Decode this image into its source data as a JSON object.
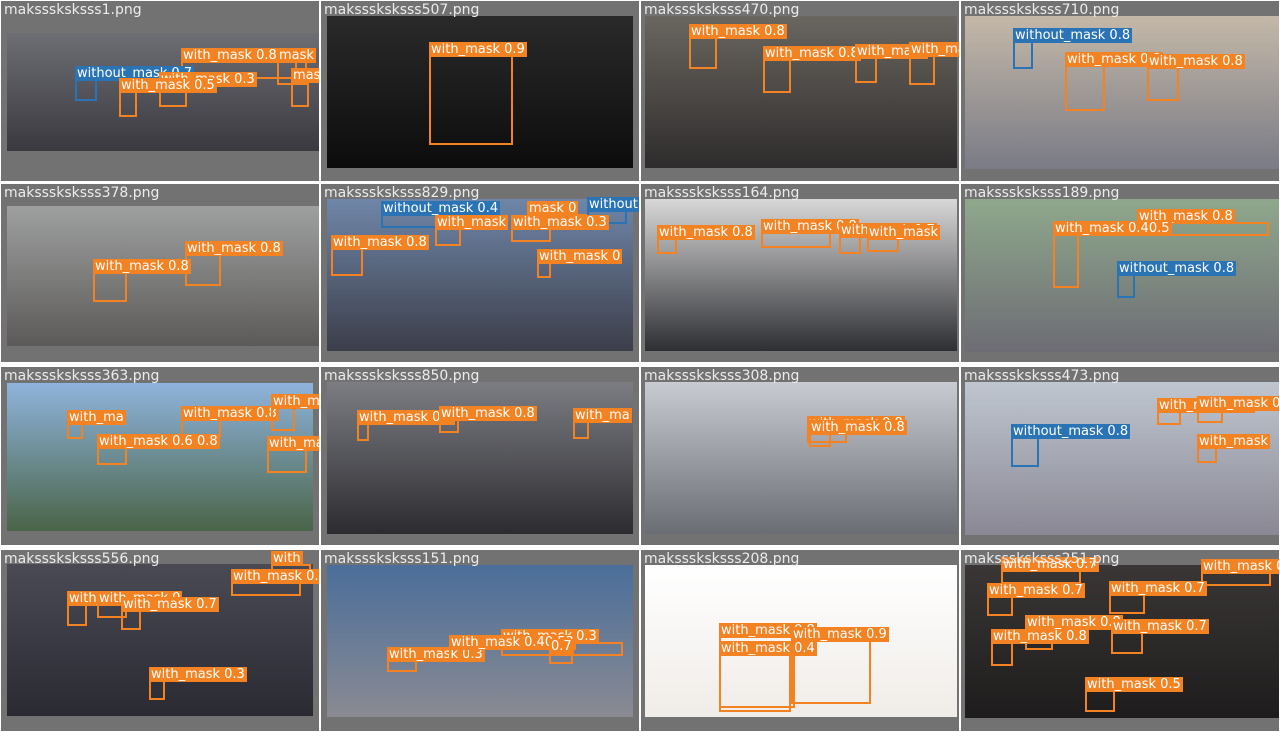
{
  "colors": {
    "with_mask": "#f28222",
    "without_mask": "#2a74b5",
    "tile_border": "#727272",
    "filename_text": "#ececec"
  },
  "tiles": [
    {
      "file": "maksssksksss1.png",
      "dets": [
        {
          "label": "with_mask 0.8",
          "cls": "with"
        },
        {
          "label": "without_mask 0.7",
          "cls": "without"
        },
        {
          "label": "with_mask 0.3",
          "cls": "with"
        },
        {
          "label": "with_mask 0.5",
          "cls": "with"
        },
        {
          "label": "mask",
          "cls": "with"
        },
        {
          "label": "mask",
          "cls": "with"
        }
      ]
    },
    {
      "file": "maksssksksss507.png",
      "dets": [
        {
          "label": "with_mask 0.9",
          "cls": "with"
        }
      ]
    },
    {
      "file": "maksssksksss470.png",
      "dets": [
        {
          "label": "with_mask 0.8",
          "cls": "with"
        },
        {
          "label": "with_mask 0.8",
          "cls": "with"
        },
        {
          "label": "with_mask",
          "cls": "with"
        },
        {
          "label": "with_mask",
          "cls": "with"
        }
      ]
    },
    {
      "file": "maksssksksss710.png",
      "dets": [
        {
          "label": "without_mask 0.8",
          "cls": "without"
        },
        {
          "label": "with_mask 0.8",
          "cls": "with"
        },
        {
          "label": "with_mask 0.8",
          "cls": "with"
        }
      ]
    },
    {
      "file": "maksssksksss378.png",
      "dets": [
        {
          "label": "with_mask 0.8",
          "cls": "with"
        },
        {
          "label": "with_mask 0.8",
          "cls": "with"
        }
      ]
    },
    {
      "file": "maksssksksss829.png",
      "dets": [
        {
          "label": "without_mask 0.4",
          "cls": "without"
        },
        {
          "label": "mask 0",
          "cls": "with"
        },
        {
          "label": "without",
          "cls": "without"
        },
        {
          "label": "with_mask 0.8",
          "cls": "with"
        },
        {
          "label": "with_mask",
          "cls": "with"
        },
        {
          "label": "with_mask 0.3",
          "cls": "with"
        },
        {
          "label": "with_mask 0",
          "cls": "with"
        }
      ]
    },
    {
      "file": "maksssksksss164.png",
      "dets": [
        {
          "label": "with_mask 0.8",
          "cls": "with"
        },
        {
          "label": "with_mask 0.8",
          "cls": "with"
        },
        {
          "label": "with_mask 0.7",
          "cls": "with"
        },
        {
          "label": "with_mask",
          "cls": "with"
        }
      ]
    },
    {
      "file": "maksssksksss189.png",
      "dets": [
        {
          "label": "with_mask 0.8",
          "cls": "with"
        },
        {
          "label": "with_mask 0.40.5",
          "cls": "with"
        },
        {
          "label": "without_mask 0.8",
          "cls": "without"
        }
      ]
    },
    {
      "file": "maksssksksss363.png",
      "dets": [
        {
          "label": "with_ma",
          "cls": "with"
        },
        {
          "label": "with_mask 0.8",
          "cls": "with"
        },
        {
          "label": "with_mask 0.8",
          "cls": "with"
        },
        {
          "label": "with_mask 0.6 0.8",
          "cls": "with"
        },
        {
          "label": "with_ma",
          "cls": "with"
        }
      ]
    },
    {
      "file": "maksssksksss850.png",
      "dets": [
        {
          "label": "with_mask 0.8",
          "cls": "with"
        },
        {
          "label": "with_mask 0.8",
          "cls": "with"
        },
        {
          "label": "with_ma",
          "cls": "with"
        }
      ]
    },
    {
      "file": "maksssksksss308.png",
      "dets": [
        {
          "label": "with_mask 0.8",
          "cls": "with"
        },
        {
          "label": "with_mask 0.8",
          "cls": "with"
        }
      ]
    },
    {
      "file": "maksssksksss473.png",
      "dets": [
        {
          "label": "with_mask 0.8",
          "cls": "with"
        },
        {
          "label": "with_mask 0.8",
          "cls": "with"
        },
        {
          "label": "without_mask 0.8",
          "cls": "without"
        },
        {
          "label": "with_mask",
          "cls": "with"
        }
      ]
    },
    {
      "file": "maksssksksss556.png",
      "dets": [
        {
          "label": "with",
          "cls": "with"
        },
        {
          "label": "with_mask 0.7",
          "cls": "with"
        },
        {
          "label": "with_mask 0.4",
          "cls": "with"
        },
        {
          "label": "with_mask 0",
          "cls": "with"
        },
        {
          "label": "with_mask 0.7",
          "cls": "with"
        },
        {
          "label": "with_mask 0.3",
          "cls": "with"
        }
      ]
    },
    {
      "file": "maksssksksss151.png",
      "dets": [
        {
          "label": "with_mask 0.3",
          "cls": "with"
        },
        {
          "label": "with_mask 0.3",
          "cls": "with"
        },
        {
          "label": "with_mask 0.40.53",
          "cls": "with"
        },
        {
          "label": "0.7",
          "cls": "with"
        }
      ]
    },
    {
      "file": "maksssksksss208.png",
      "dets": [
        {
          "label": "with_mask 0.8",
          "cls": "with"
        },
        {
          "label": "with_mask 0.9",
          "cls": "with"
        },
        {
          "label": "with_mask 0.4",
          "cls": "with"
        }
      ]
    },
    {
      "file": "maksssksksss251.png",
      "dets": [
        {
          "label": "with_mask 0.7",
          "cls": "with"
        },
        {
          "label": "with_mask 0.5",
          "cls": "with"
        },
        {
          "label": "with_mask 0.7",
          "cls": "with"
        },
        {
          "label": "with_mask 0.7",
          "cls": "with"
        },
        {
          "label": "with_mask 0.8",
          "cls": "with"
        },
        {
          "label": "with_mask 0.7",
          "cls": "with"
        },
        {
          "label": "with_mask 0.8",
          "cls": "with"
        },
        {
          "label": "with_mask 0.5",
          "cls": "with"
        }
      ]
    }
  ]
}
